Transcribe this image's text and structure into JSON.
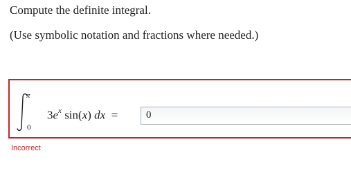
{
  "question": {
    "prompt": "Compute the definite integral.",
    "hint": "(Use symbolic notation and fractions where needed.)"
  },
  "integral": {
    "upper_limit": "π",
    "lower_limit": "0",
    "coefficient": "3",
    "base": "e",
    "exponent": "x",
    "function": "sin(",
    "argument": "x",
    "close_paren": ")",
    "differential_d": "d",
    "differential_var": "x",
    "equals": "="
  },
  "answer": {
    "value": "0",
    "status": "Incorrect",
    "status_color": "#c0272d"
  }
}
